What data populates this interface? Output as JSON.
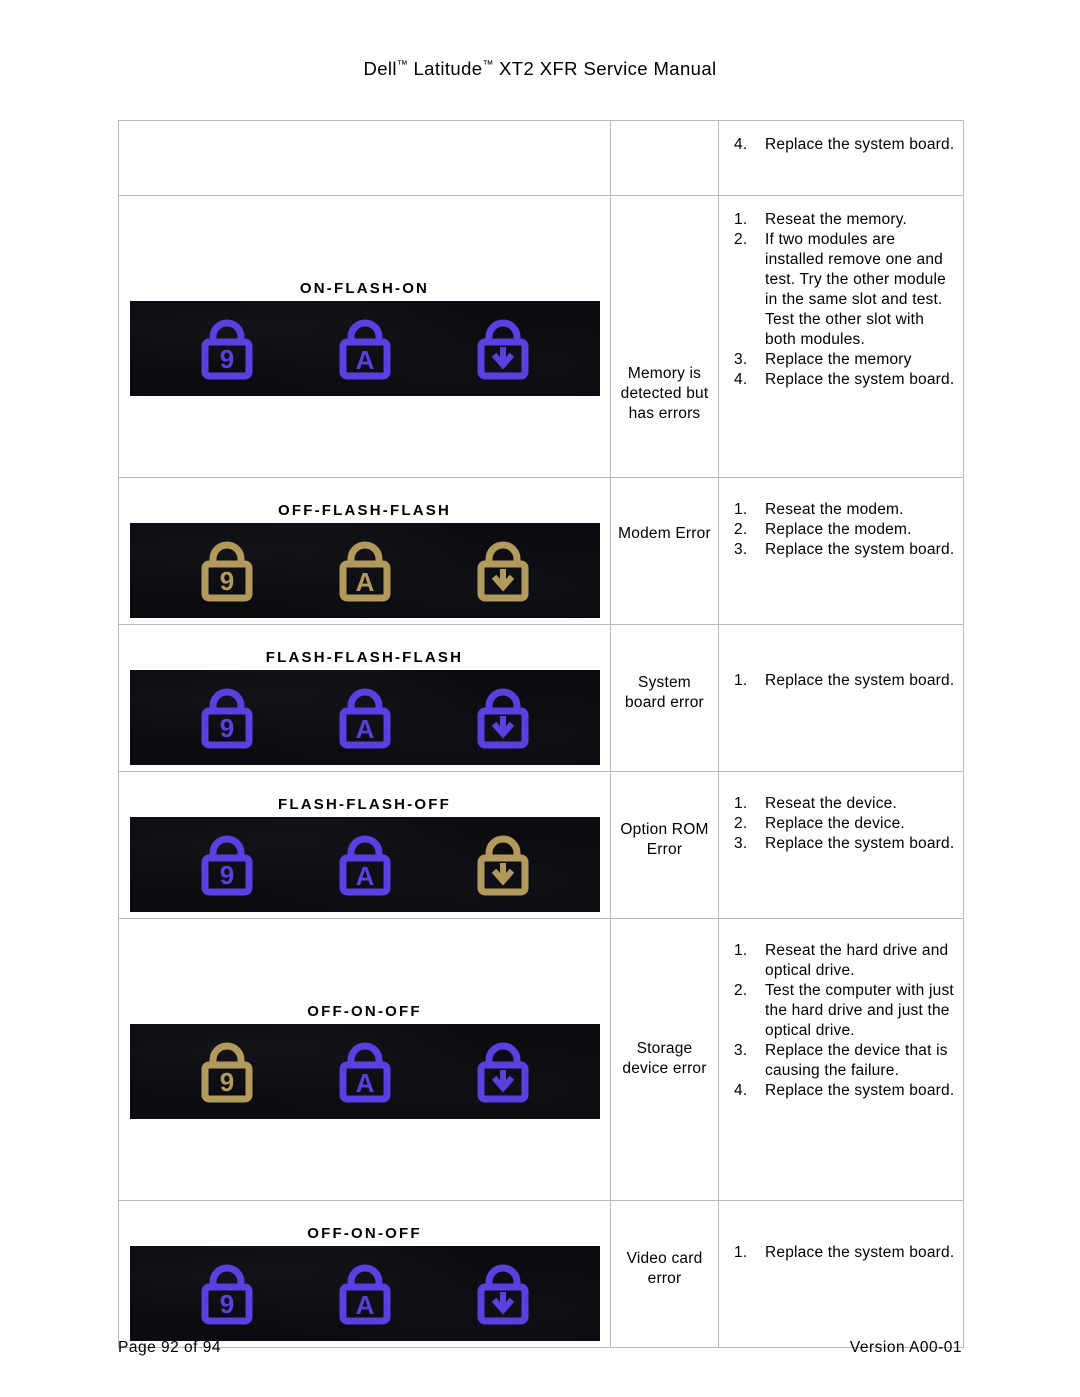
{
  "header": {
    "title_part1": "Dell",
    "tm1": "™",
    "title_part2": " Latitude",
    "tm2": "™",
    "title_part3": " XT2 XFR Service Manual"
  },
  "footer": {
    "page_label": "Page 92 of  94",
    "version_label": "Version A00-01"
  },
  "table": {
    "rows": [
      {
        "id": "row-continued",
        "code": "",
        "description": "",
        "steps": [
          {
            "num": "4.",
            "text": "Replace the system board."
          }
        ]
      },
      {
        "id": "row-on-flash-on",
        "code": "ON-FLASH-ON",
        "description": "Memory is detected but has errors",
        "steps": [
          {
            "num": "1.",
            "text": "Reseat the memory."
          },
          {
            "num": "2.",
            "text": "If two modules are installed remove one and test. Try the other module in the same slot and test. Test the other slot with both modules."
          },
          {
            "num": "3.",
            "text": "Replace the memory"
          },
          {
            "num": "4.",
            "text": "Replace the system board."
          }
        ]
      },
      {
        "id": "row-off-flash-flash",
        "code": "OFF-FLASH-FLASH",
        "description": "Modem Error",
        "steps": [
          {
            "num": "1.",
            "text": "Reseat the modem."
          },
          {
            "num": "2.",
            "text": "Replace the modem."
          },
          {
            "num": "3.",
            "text": "Replace the system board."
          }
        ]
      },
      {
        "id": "row-flash-flash-flash",
        "code": "FLASH-FLASH-FLASH",
        "description": "System board error",
        "steps": [
          {
            "num": "1.",
            "text": "Replace the system board."
          }
        ]
      },
      {
        "id": "row-flash-flash-off",
        "code": "FLASH-FLASH-OFF",
        "description": "Option ROM Error",
        "steps": [
          {
            "num": "1.",
            "text": "Reseat the device."
          },
          {
            "num": "2.",
            "text": "Replace the device."
          },
          {
            "num": "3.",
            "text": "Replace the system board."
          }
        ]
      },
      {
        "id": "row-off-on-off-storage",
        "code": "OFF-ON-OFF",
        "description": "Storage device error",
        "steps": [
          {
            "num": "1.",
            "text": "Reseat the hard drive and optical drive."
          },
          {
            "num": "2.",
            "text": "Test the computer with just the hard drive and just the optical drive."
          },
          {
            "num": "3.",
            "text": "Replace the device that is causing the failure."
          },
          {
            "num": "4.",
            "text": "Replace the system board."
          }
        ]
      },
      {
        "id": "row-off-on-off-video",
        "code": "OFF-ON-OFF",
        "description": "Video card error",
        "steps": [
          {
            "num": "1.",
            "text": "Replace the system board."
          }
        ]
      }
    ]
  },
  "led_images": {
    "caption": "Three status LED lock icons: num-lock (9), caps-lock (A), scroll-lock (down arrow)",
    "colors": {
      "on": "#5b3fe0",
      "off": "#b39a5c",
      "background": "#0b0b12"
    },
    "icons": [
      "num-lock-icon",
      "caps-lock-icon",
      "scroll-lock-icon"
    ],
    "states": [
      {
        "row": "row-on-flash-on",
        "leds": [
          "on",
          "on",
          "on"
        ]
      },
      {
        "row": "row-off-flash-flash",
        "leds": [
          "off",
          "off",
          "off"
        ]
      },
      {
        "row": "row-flash-flash-flash",
        "leds": [
          "on",
          "on",
          "on"
        ]
      },
      {
        "row": "row-flash-flash-off",
        "leds": [
          "on",
          "on",
          "off"
        ]
      },
      {
        "row": "row-off-on-off-storage",
        "leds": [
          "off",
          "on",
          "on"
        ]
      },
      {
        "row": "row-off-on-off-video",
        "leds": [
          "on",
          "on",
          "on"
        ]
      }
    ]
  }
}
